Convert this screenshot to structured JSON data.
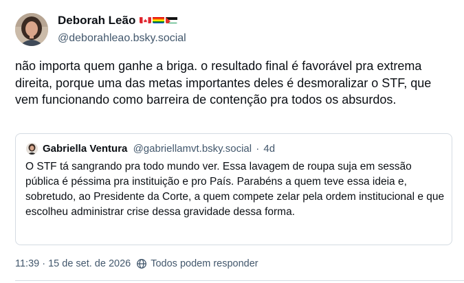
{
  "post": {
    "author": {
      "name": "Deborah Leão",
      "handle": "@deborahleao.bsky.social",
      "flags": [
        "canada-flag-icon",
        "rainbow-flag-icon",
        "palestine-flag-icon"
      ]
    },
    "text": "não importa quem ganhe a briga. o resultado final é favorável pra extrema direita, porque uma das metas importantes deles é desmoralizar o STF, que vem funcionando como barreira de contenção pra todos os absurdos.",
    "quote": {
      "name": "Gabriella Ventura",
      "handle": "@gabriellamvt.bsky.social",
      "separator": "·",
      "time": "4d",
      "text": "O STF tá sangrando pra todo mundo ver. Essa lavagem de roupa suja em sessão pública é péssima pra instituição e pro País. Parabéns a quem teve essa ideia e, sobretudo, ao Presidente da Corte, a quem compete zelar pela ordem institucional e que escolheu administrar crise dessa gravidade dessa forma."
    },
    "meta": {
      "timestamp": "11:39 · 15 de set. de 2026",
      "reply_setting": "Todos podem responder",
      "reply_icon": "globe-icon"
    }
  },
  "colors": {
    "text": "#0b0f14",
    "muted": "#42576c",
    "border": "#d4dbe2"
  }
}
